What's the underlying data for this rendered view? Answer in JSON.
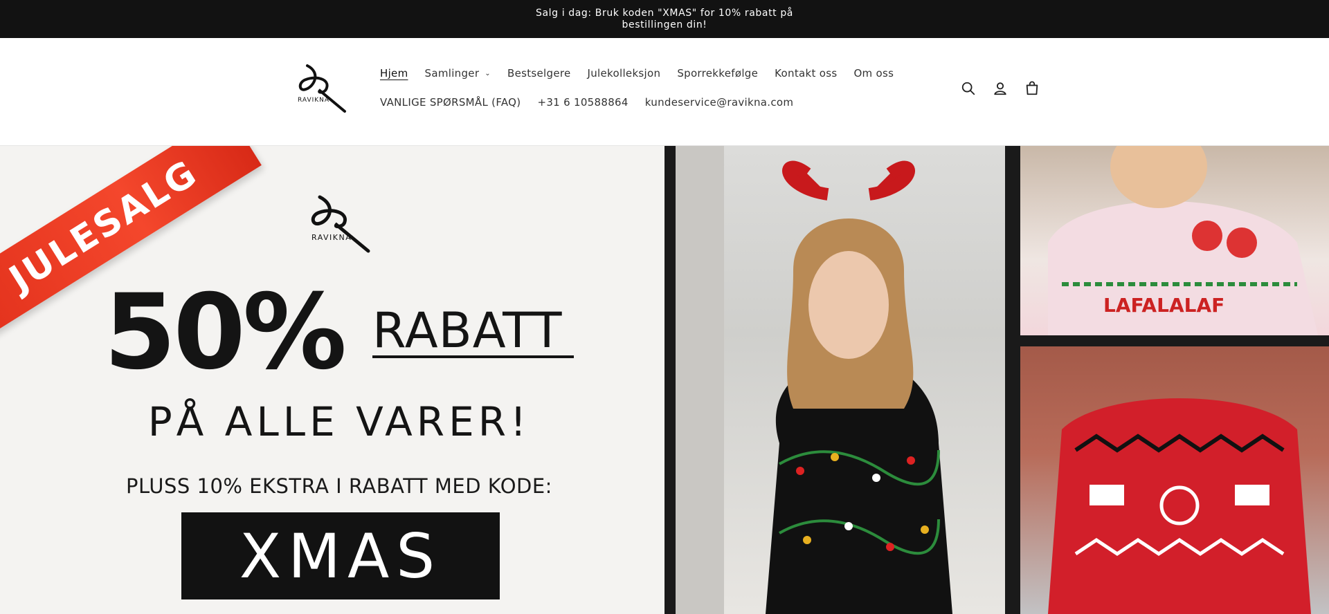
{
  "announcement": {
    "text": "Salg i dag: Bruk koden \"XMAS\" for 10% rabatt på bestillingen din!"
  },
  "header": {
    "logo_text": "RAVIKNA",
    "nav_row1": [
      {
        "label": "Hjem",
        "active": true
      },
      {
        "label": "Samlinger",
        "has_dropdown": true
      },
      {
        "label": "Bestselgere"
      },
      {
        "label": "Julekolleksjon"
      },
      {
        "label": "Sporrekkefølge"
      },
      {
        "label": "Kontakt oss"
      },
      {
        "label": "Om oss"
      }
    ],
    "nav_row2": [
      {
        "label": "VANLIGE SPØRSMÅL (FAQ)"
      },
      {
        "label": "+31 6 10588864"
      },
      {
        "label": "kundeservice@ravikna.com"
      }
    ],
    "icons": [
      "search-icon",
      "account-icon",
      "cart-icon"
    ]
  },
  "hero": {
    "ribbon": "JULESALG",
    "logo_text": "RAVIKNA",
    "percent": "50%",
    "rabatt": "RABATT",
    "alle": "PÅ ALLE VARER!",
    "pluss": "PLUSS 10% EKSTRA I RABATT MED KODE:",
    "code": "XMAS",
    "colors": {
      "ribbon": "#e2311c",
      "code_bg": "#121212",
      "promo_bg": "#f4f3f1"
    }
  }
}
